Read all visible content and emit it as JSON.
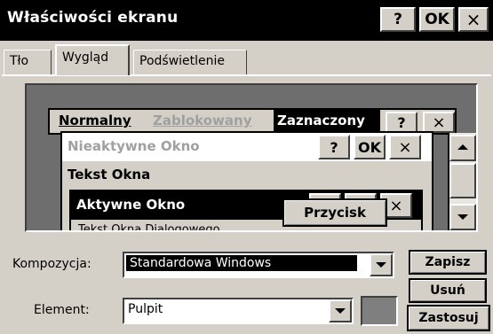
{
  "window": {
    "title": "Właściwości ekranu",
    "help_label": "?",
    "ok_label": "OK",
    "close_label": "×"
  },
  "tabs": [
    {
      "label": "Tło",
      "active": false
    },
    {
      "label": "Wygląd",
      "active": true
    },
    {
      "label": "Podświetlenie",
      "active": false
    }
  ],
  "preview": {
    "menu": {
      "normal": "Normalny",
      "disabled": "Zablokowany",
      "selected": "Zaznaczony",
      "help": "?",
      "close": "×"
    },
    "inactive_window": {
      "title": "Nieaktywne Okno",
      "help": "?",
      "ok": "OK",
      "close": "×",
      "window_text": "Tekst Okna"
    },
    "active_window": {
      "title": "Aktywne Okno",
      "close": "×",
      "dialog_text": "Tekst Okna Dialogowego",
      "button": "Przycisk"
    }
  },
  "form": {
    "scheme_label": "Kompozycja:",
    "scheme_value": "Standardowa Windows",
    "element_label": "Element:",
    "element_value": "Pulpit",
    "element_color": "#7f7f7f"
  },
  "buttons": {
    "save": "Zapisz",
    "delete": "Usuń",
    "apply": "Zastosuj"
  }
}
